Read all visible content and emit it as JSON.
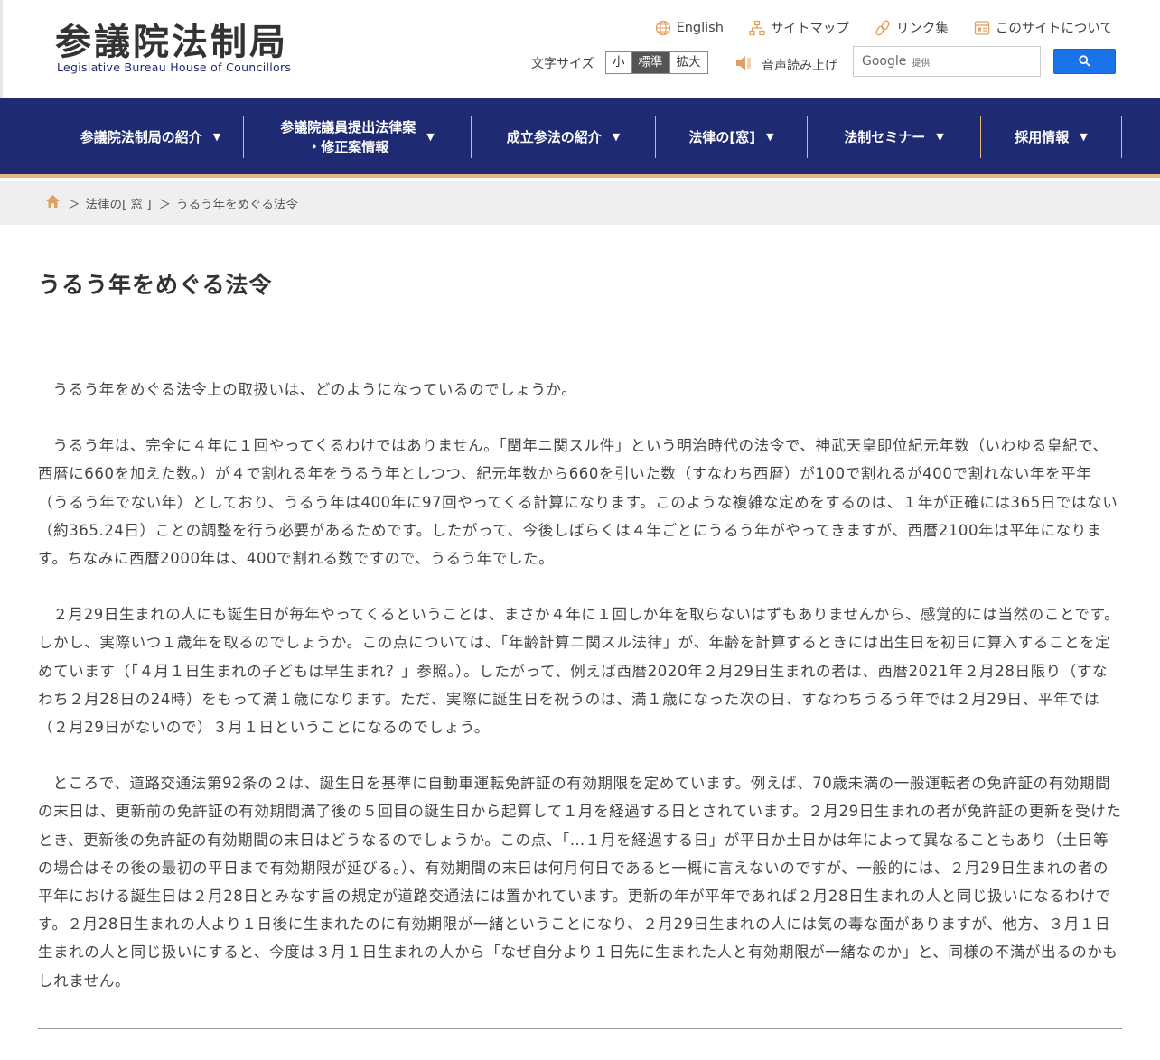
{
  "header": {
    "logo_jp": "参議院法制局",
    "logo_en": "Legislative Bureau House of Councillors",
    "toplinks": [
      {
        "label": "English",
        "icon": "globe-icon"
      },
      {
        "label": "サイトマップ",
        "icon": "sitemap-icon"
      },
      {
        "label": "リンク集",
        "icon": "link-icon"
      },
      {
        "label": "このサイトについて",
        "icon": "info-icon"
      }
    ],
    "fontsize_label": "文字サイズ",
    "fontsize_options": [
      "小",
      "標準",
      "拡大"
    ],
    "fontsize_selected": "標準",
    "speech_label": "音声読み上げ",
    "search_brand": "Google",
    "search_provided": "提供",
    "search_button_icon": "search-icon"
  },
  "nav": {
    "items": [
      {
        "label": "参議院法制局の紹介"
      },
      {
        "label": "参議院議員提出法律案\n・修正案情報"
      },
      {
        "label": "成立参法の紹介"
      },
      {
        "label": "法律の[窓]"
      },
      {
        "label": "法制セミナー"
      },
      {
        "label": "採用情報"
      }
    ],
    "arrow": "▼"
  },
  "breadcrumb": {
    "home_icon": "home-icon",
    "items": [
      "法律の[ 窓 ]",
      "うるう年をめぐる法令"
    ],
    "separator": "＞"
  },
  "page": {
    "title": "うるう年をめぐる法令",
    "paragraphs": [
      "うるう年をめぐる法令上の取扱いは、どのようになっているのでしょうか。",
      "うるう年は、完全に４年に１回やってくるわけではありません。「閏年ニ関スル件」という明治時代の法令で、神武天皇即位紀元年数（いわゆる皇紀で、西暦に660を加えた数。）が４で割れる年をうるう年としつつ、紀元年数から660を引いた数（すなわち西暦）が100で割れるが400で割れない年を平年（うるう年でない年）としており、うるう年は400年に97回やってくる計算になります。このような複雑な定めをするのは、１年が正確には365日ではない（約365.24日）ことの調整を行う必要があるためです。したがって、今後しばらくは４年ごとにうるう年がやってきますが、西暦2100年は平年になります。ちなみに西暦2000年は、400で割れる数ですので、うるう年でした。",
      "２月29日生まれの人にも誕生日が毎年やってくるということは、まさか４年に１回しか年を取らないはずもありませんから、感覚的には当然のことです。しかし、実際いつ１歳年を取るのでしょうか。この点については、「年齢計算ニ関スル法律」が、年齢を計算するときには出生日を初日に算入することを定めています（「４月１日生まれの子どもは早生まれ？」参照。）。したがって、例えば西暦2020年２月29日生まれの者は、西暦2021年２月28日限り（すなわち２月28日の24時）をもって満１歳になります。ただ、実際に誕生日を祝うのは、満１歳になった次の日、すなわちうるう年では２月29日、平年では（２月29日がないので）３月１日ということになるのでしょう。",
      "ところで、道路交通法第92条の２は、誕生日を基準に自動車運転免許証の有効期限を定めています。例えば、70歳未満の一般運転者の免許証の有効期間の末日は、更新前の免許証の有効期間満了後の５回目の誕生日から起算して１月を経過する日とされています。２月29日生まれの者が免許証の更新を受けたとき、更新後の免許証の有効期間の末日はどうなるのでしょうか。この点、「…１月を経過する日」が平日か土日かは年によって異なることもあり（土日等の場合はその後の最初の平日まで有効期限が延びる。）、有効期間の末日は何月何日であると一概に言えないのですが、一般的には、２月29日生まれの者の平年における誕生日は２月28日とみなす旨の規定が道路交通法には置かれています。更新の年が平年であれば２月28日生まれの人と同じ扱いになるわけです。２月28日生まれの人より１日後に生まれたのに有効期限が一緒ということになり、２月29日生まれの人には気の毒な面がありますが、他方、３月１日生まれの人と同じ扱いにすると、今度は３月１日生まれの人から「なぜ自分より１日先に生まれた人と有効期限が一緒なのか」と、同様の不満が出るのかもしれません。"
    ]
  }
}
